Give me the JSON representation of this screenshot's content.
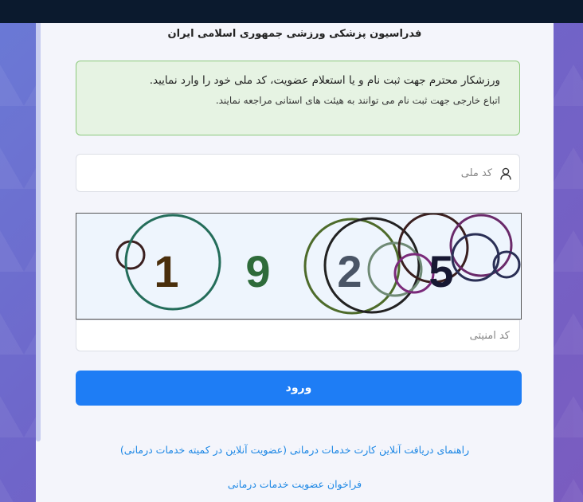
{
  "header": {
    "title": "فدراسیون پزشکی ورزشی جمهوری اسلامی ایران"
  },
  "alert": {
    "line1": "ورزشکار محترم جهت ثبت نام و یا استعلام عضویت، کد ملی خود را وارد نمایید.",
    "line2": "اتباع خارجی جهت ثبت نام می توانند به هیئت های استانی مراجعه نمایند.",
    "colors": {
      "background": "#e6f3e3",
      "border": "#8cc97c"
    }
  },
  "form": {
    "national_code_placeholder": "کد ملی",
    "national_code_icon": "user-icon",
    "captcha_digits": [
      "1",
      "9",
      "2",
      "5"
    ],
    "captcha_digit_colors": [
      "#4a2f0c",
      "#2e6b3a",
      "#4a5566",
      "#171833"
    ],
    "security_code_placeholder": "کد امنیتی",
    "submit_label": "ورود",
    "submit_color": "#1e7df5"
  },
  "links": {
    "guide": "راهنمای دریافت آنلاین کارت خدمات درمانی (عضویت آنلاین در کمیته خدمات درمانی)",
    "call": "فراخوان عضویت خدمات درمانی"
  }
}
